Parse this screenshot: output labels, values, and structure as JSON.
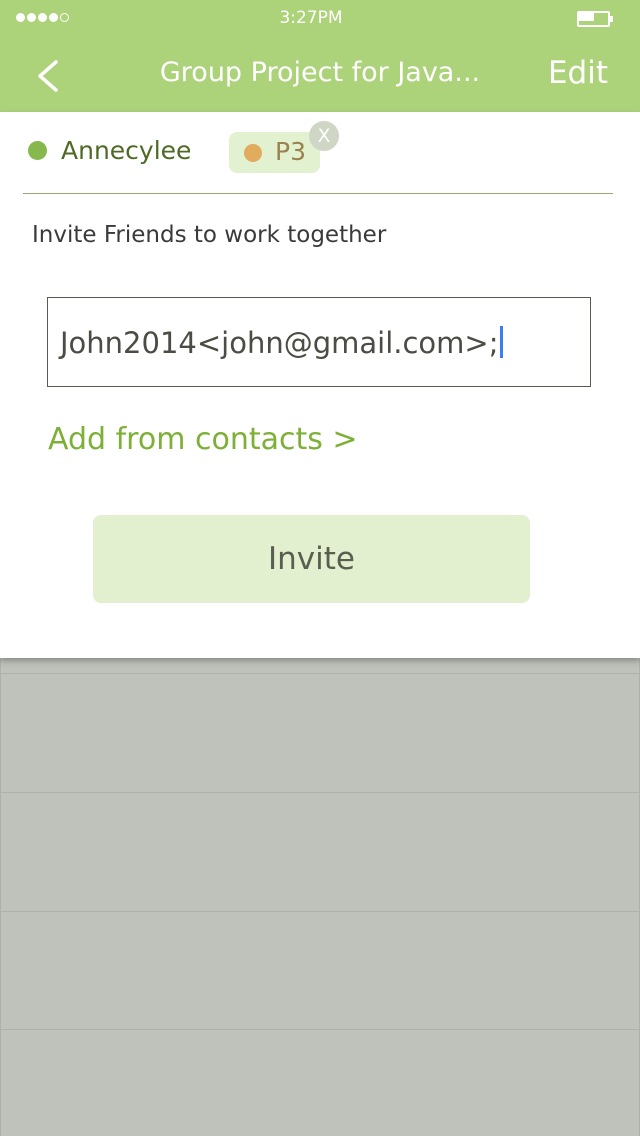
{
  "status_bar": {
    "time": "3:27PM",
    "signal_icon": "signal-dots-icon",
    "battery_icon": "battery-icon",
    "battery_level": 0.5
  },
  "nav": {
    "back_icon": "chevron-left-icon",
    "title": "Group Project for Java...",
    "edit_label": "Edit"
  },
  "members": [
    {
      "name": "Annecylee",
      "status_color": "#86b84e"
    },
    {
      "name": "P3",
      "status_color": "#e1ac5d",
      "removable": true,
      "remove_label": "X"
    }
  ],
  "invite": {
    "heading": "Invite Friends to work together",
    "input_value": "John2014<john@gmail.com>;",
    "add_contacts_label": "Add from contacts >",
    "button_label": "Invite"
  },
  "colors": {
    "header": "#acd37a",
    "accent": "#7db037",
    "button_bg": "#e2f0cf",
    "backdrop": "#bfc1bb"
  }
}
